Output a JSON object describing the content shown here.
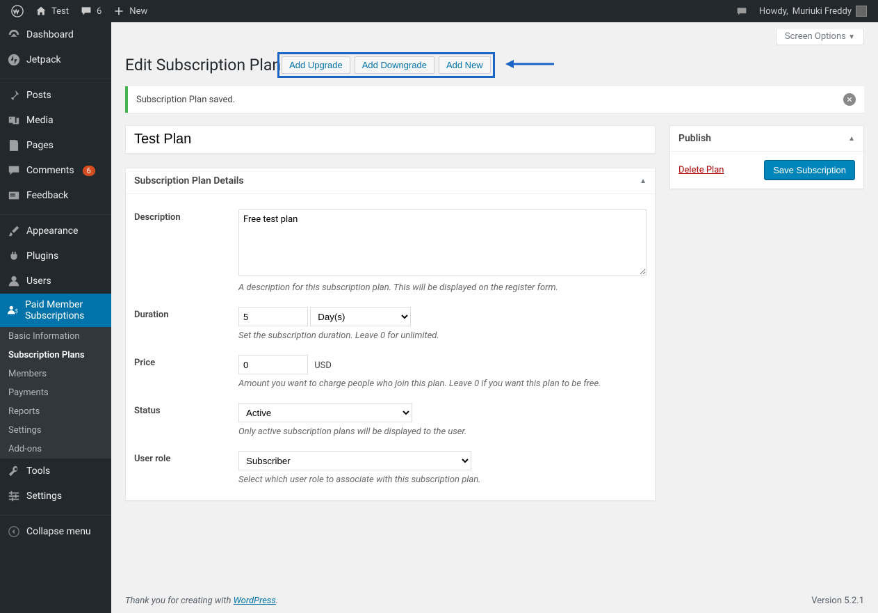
{
  "adminbar": {
    "site_name": "Test",
    "comment_count": "6",
    "new_label": "New",
    "howdy_prefix": "Howdy, ",
    "user_name": "Muriuki Freddy"
  },
  "menu": {
    "items": [
      {
        "id": "dashboard",
        "label": "Dashboard",
        "icon": "dashboard"
      },
      {
        "id": "jetpack",
        "label": "Jetpack",
        "icon": "jetpack"
      }
    ],
    "items2": [
      {
        "id": "posts",
        "label": "Posts",
        "icon": "pin"
      },
      {
        "id": "media",
        "label": "Media",
        "icon": "media"
      },
      {
        "id": "pages",
        "label": "Pages",
        "icon": "page"
      },
      {
        "id": "comments",
        "label": "Comments",
        "icon": "comment",
        "badge": "6"
      },
      {
        "id": "feedback",
        "label": "Feedback",
        "icon": "feedback"
      }
    ],
    "items3": [
      {
        "id": "appearance",
        "label": "Appearance",
        "icon": "brush"
      },
      {
        "id": "plugins",
        "label": "Plugins",
        "icon": "plug"
      },
      {
        "id": "users",
        "label": "Users",
        "icon": "user"
      },
      {
        "id": "pms",
        "label": "Paid Member Subscriptions",
        "icon": "pms",
        "current": true
      }
    ],
    "sub_pms": [
      {
        "id": "basic",
        "label": "Basic Information"
      },
      {
        "id": "plans",
        "label": "Subscription Plans",
        "current": true
      },
      {
        "id": "members",
        "label": "Members"
      },
      {
        "id": "payments",
        "label": "Payments"
      },
      {
        "id": "reports",
        "label": "Reports"
      },
      {
        "id": "settings",
        "label": "Settings"
      },
      {
        "id": "addons",
        "label": "Add-ons"
      }
    ],
    "items4": [
      {
        "id": "tools",
        "label": "Tools",
        "icon": "wrench"
      },
      {
        "id": "settings",
        "label": "Settings",
        "icon": "sliders"
      }
    ],
    "collapse_label": "Collapse menu"
  },
  "screen_options": "Screen Options",
  "page": {
    "title": "Edit Subscription Plan",
    "actions": {
      "upgrade": "Add Upgrade",
      "downgrade": "Add Downgrade",
      "addnew": "Add New"
    },
    "notice": "Subscription Plan saved.",
    "plan_title": "Test Plan",
    "details_heading": "Subscription Plan Details",
    "fields": {
      "description": {
        "label": "Description",
        "value": "Free test plan",
        "help": "A description for this subscription plan. This will be displayed on the register form."
      },
      "duration": {
        "label": "Duration",
        "value": "5",
        "unit": "Day(s)",
        "help": "Set the subscription duration. Leave 0 for unlimited."
      },
      "price": {
        "label": "Price",
        "value": "0",
        "currency": "USD",
        "help": "Amount you want to charge people who join this plan. Leave 0 if you want this plan to be free."
      },
      "status": {
        "label": "Status",
        "value": "Active",
        "help": "Only active subscription plans will be displayed to the user."
      },
      "user_role": {
        "label": "User role",
        "value": "Subscriber",
        "help": "Select which user role to associate with this subscription plan."
      }
    },
    "publish": {
      "heading": "Publish",
      "delete": "Delete Plan",
      "save": "Save Subscription"
    }
  },
  "footer": {
    "thanks_prefix": "Thank you for creating with ",
    "link": "WordPress",
    "suffix": ".",
    "version": "Version 5.2.1"
  }
}
